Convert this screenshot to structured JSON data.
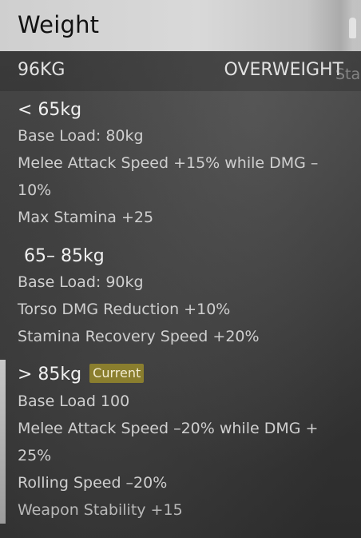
{
  "header": {
    "title": "Weight"
  },
  "status": {
    "weight": "96KG",
    "label": "OVERWEIGHT",
    "clipped_text": "Sta"
  },
  "tiers": [
    {
      "name": "< 65kg",
      "lines": [
        "Base Load: 80kg",
        "Melee Attack Speed +15% while DMG –",
        "10%",
        "Max Stamina +25"
      ]
    },
    {
      "name": "65– 85kg",
      "lines": [
        "Base Load: 90kg",
        "Torso DMG Reduction +10%",
        "Stamina Recovery Speed +20%"
      ]
    },
    {
      "name": "> 85kg",
      "badge": "Current",
      "lines": [
        "Base Load 100",
        "Melee Attack Speed –20% while DMG +",
        "25%",
        "Rolling Speed –20%",
        "Weapon Stability +15"
      ]
    }
  ],
  "colors": {
    "header_bg": "#d9d9d9",
    "badge_bg": "#8a7e2e",
    "current_marker": "#c8c8c8"
  }
}
